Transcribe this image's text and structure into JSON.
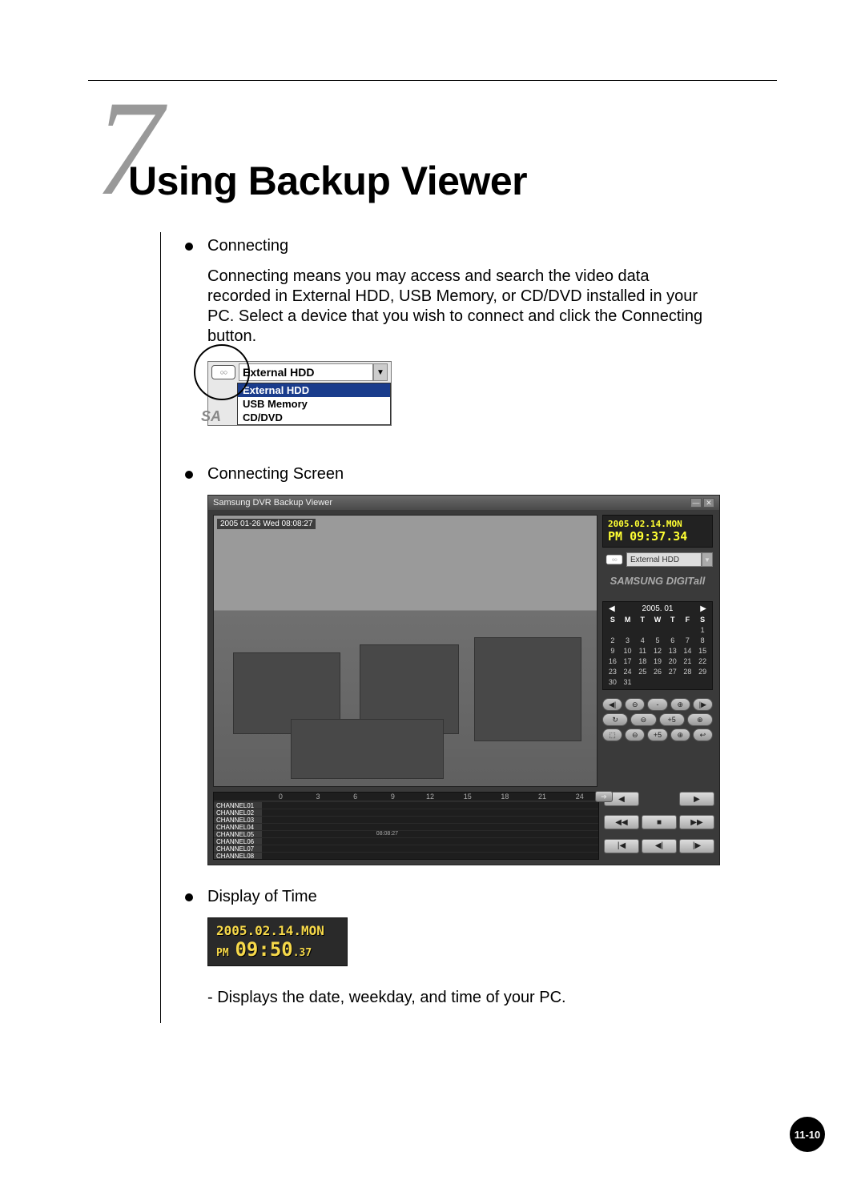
{
  "chapter_number": "7",
  "title": "Using Backup Viewer",
  "sections": {
    "connecting": {
      "heading": "Connecting",
      "paragraph": "Connecting means you may access and search the video data recorded in External HDD, USB Memory, or CD/DVD installed in your PC. Select a device that you wish to connect and click the Connecting button."
    },
    "connecting_screen": {
      "heading": "Connecting Screen"
    },
    "display_time": {
      "heading": "Display of Time",
      "note": "- Displays the date, weekday, and time of your PC."
    }
  },
  "device_select": {
    "selected": "External HDD",
    "options": [
      "External HDD",
      "USB Memory",
      "CD/DVD"
    ],
    "brand_hint": "SA"
  },
  "viewer": {
    "title": "Samsung DVR Backup Viewer",
    "video_overlay": "2005 01-26 Wed 08:08:27",
    "date": "2005.02.14.MON",
    "time_prefix": "PM",
    "time_main": "09:37",
    "time_sec": ".34",
    "hdd_label": "External HDD",
    "brand_logo": "SAMSUNG DIGITall",
    "calendar": {
      "month": "2005. 01",
      "days_header": [
        "S",
        "M",
        "T",
        "W",
        "T",
        "F",
        "S"
      ],
      "cells": [
        "",
        "",
        "",
        "",
        "",
        "",
        "1",
        "2",
        "3",
        "4",
        "5",
        "6",
        "7",
        "8",
        "9",
        "10",
        "11",
        "12",
        "13",
        "14",
        "15",
        "16",
        "17",
        "18",
        "19",
        "20",
        "21",
        "22",
        "23",
        "24",
        "25",
        "26",
        "27",
        "28",
        "29",
        "30",
        "31",
        "",
        "",
        "",
        "",
        ""
      ]
    },
    "control_labels": [
      "-5",
      "+5",
      "+5"
    ],
    "timeline": {
      "hours": [
        "0",
        "3",
        "6",
        "9",
        "12",
        "15",
        "18",
        "21",
        "24"
      ],
      "channels": [
        "CHANNEL01",
        "CHANNEL02",
        "CHANNEL03",
        "CHANNEL04",
        "CHANNEL05",
        "CHANNEL06",
        "CHANNEL07",
        "CHANNEL08"
      ],
      "marker": "08:08:27"
    },
    "playback_icons": [
      "◀",
      "▶",
      "◀◀",
      "■",
      "▶▶",
      "|◀",
      "◀|",
      "|▶",
      "▶|"
    ]
  },
  "time_display": {
    "date": "2005.02.14.MON",
    "pm": "PM",
    "time": "09:50",
    "sec": ".37"
  },
  "page_number": "11-10"
}
